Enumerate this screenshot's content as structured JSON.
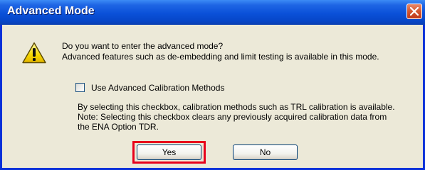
{
  "dialog": {
    "title": "Advanced Mode",
    "message_line1": "Do you want to enter the advanced mode?",
    "message_line2": "Advanced features such as de-embedding and limit testing is available in this mode.",
    "checkbox_label": "Use Advanced Calibration Methods",
    "checkbox_checked": false,
    "note_line1": "By selecting this checkbox, calibration methods such as TRL calibration is available.",
    "note_line2": "Note: Selecting this checkbox clears any previously acquired calibration data from",
    "note_line3": "the ENA Option TDR.",
    "yes_label": "Yes",
    "no_label": "No"
  },
  "icons": {
    "warning": "warning-icon",
    "close": "close-icon"
  },
  "colors": {
    "titlebar": "#0a50d8",
    "close_button": "#d4552e",
    "highlight": "#e8001c",
    "dialog_bg": "#ece9d8"
  }
}
